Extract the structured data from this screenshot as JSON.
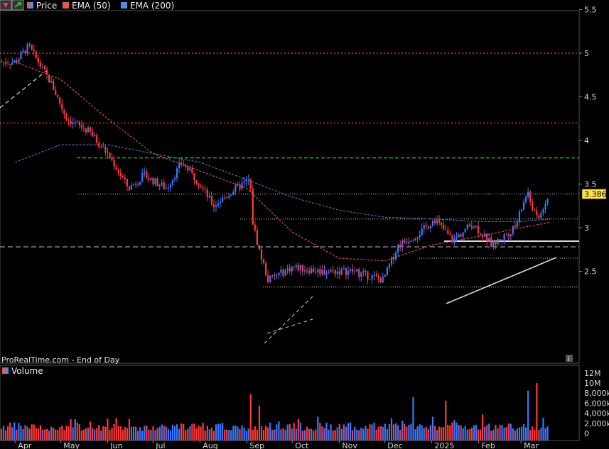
{
  "header": {
    "price_label": "Price",
    "ema50_label": "EMA (50)",
    "ema200_label": "EMA (200)",
    "colors": {
      "price_swatch": "#e05a5a",
      "ema50": "#e05a5a",
      "ema200": "#5a8ae0"
    }
  },
  "watermark": "ProRealTime.com - End of Day",
  "info_icon": "info-icon",
  "volume_panel": {
    "label": "Volume"
  },
  "last_price": "3.386",
  "colors": {
    "up": "#3a78ff",
    "down": "#ff3a3a",
    "ema50": "#d2534a",
    "ema200": "#4d6fb8",
    "resistance": "#ff2a2a",
    "support_green": "#33cc33",
    "last_price_box": "#ffe24a"
  },
  "chart_data": [
    {
      "type": "candlestick",
      "title": "",
      "y_axis": {
        "ticks": [
          "5.5",
          "5",
          "4.5",
          "4",
          "3.5",
          "3",
          "2.5"
        ],
        "range": [
          2.2,
          5.6
        ]
      },
      "x_axis": {
        "ticks": [
          "Apr",
          "May",
          "Jun",
          "Jul",
          "Aug",
          "Sep",
          "Oct",
          "Nov",
          "Dec",
          "2025",
          "Feb",
          "Mar"
        ]
      },
      "price_path": [
        [
          "2024-04-01",
          4.9
        ],
        [
          "2024-04-10",
          5.08
        ],
        [
          "2024-04-25",
          4.65
        ],
        [
          "2024-05-05",
          4.25
        ],
        [
          "2024-05-20",
          4.1
        ],
        [
          "2024-06-01",
          3.85
        ],
        [
          "2024-06-15",
          3.45
        ],
        [
          "2024-06-25",
          3.6
        ],
        [
          "2024-07-10",
          3.45
        ],
        [
          "2024-07-20",
          3.75
        ],
        [
          "2024-08-01",
          3.5
        ],
        [
          "2024-08-10",
          3.25
        ],
        [
          "2024-08-25",
          3.45
        ],
        [
          "2024-09-03",
          3.55
        ],
        [
          "2024-09-05",
          3.05
        ],
        [
          "2024-09-09",
          2.75
        ],
        [
          "2024-09-15",
          2.4
        ],
        [
          "2024-10-01",
          2.55
        ],
        [
          "2024-10-20",
          2.5
        ],
        [
          "2024-11-10",
          2.5
        ],
        [
          "2024-11-30",
          2.4
        ],
        [
          "2024-12-10",
          2.8
        ],
        [
          "2024-12-25",
          2.95
        ],
        [
          "2025-01-03",
          3.1
        ],
        [
          "2025-01-15",
          2.85
        ],
        [
          "2025-01-28",
          3.05
        ],
        [
          "2025-02-10",
          2.8
        ],
        [
          "2025-02-25",
          3.0
        ],
        [
          "2025-03-05",
          3.4
        ],
        [
          "2025-03-12",
          3.08
        ],
        [
          "2025-03-20",
          3.386
        ]
      ],
      "ema50_path": [
        [
          "2024-04-01",
          4.9
        ],
        [
          "2024-05-01",
          4.7
        ],
        [
          "2024-06-01",
          4.25
        ],
        [
          "2024-07-01",
          3.85
        ],
        [
          "2024-08-01",
          3.65
        ],
        [
          "2024-09-01",
          3.45
        ],
        [
          "2024-10-01",
          2.95
        ],
        [
          "2024-11-01",
          2.65
        ],
        [
          "2024-12-01",
          2.62
        ],
        [
          "2025-01-01",
          2.8
        ],
        [
          "2025-02-01",
          2.9
        ],
        [
          "2025-03-01",
          3.0
        ],
        [
          "2025-03-20",
          3.06
        ]
      ],
      "ema200_path": [
        [
          "2024-04-01",
          3.75
        ],
        [
          "2024-05-01",
          3.95
        ],
        [
          "2024-06-01",
          3.95
        ],
        [
          "2024-07-01",
          3.85
        ],
        [
          "2024-08-01",
          3.75
        ],
        [
          "2024-09-01",
          3.55
        ],
        [
          "2024-10-01",
          3.35
        ],
        [
          "2024-11-01",
          3.2
        ],
        [
          "2024-12-01",
          3.12
        ],
        [
          "2025-01-01",
          3.1
        ],
        [
          "2025-02-01",
          3.07
        ],
        [
          "2025-03-01",
          3.07
        ],
        [
          "2025-03-20",
          3.1
        ]
      ],
      "horizontal_levels": [
        {
          "value": 5.0,
          "style": "red-dotted"
        },
        {
          "value": 4.2,
          "style": "red-dotted"
        },
        {
          "value": 3.8,
          "style": "green-dashed"
        },
        {
          "value": 3.386,
          "style": "white-dotted"
        },
        {
          "value": 3.1,
          "style": "white-dotted"
        },
        {
          "value": 2.78,
          "style": "white-dashed"
        },
        {
          "value": 2.65,
          "style": "white-dotted"
        },
        {
          "value": 2.32,
          "style": "white-dotted"
        }
      ],
      "last_price": 3.386
    },
    {
      "type": "bar",
      "title": "Volume",
      "y_axis": {
        "ticks": [
          "12M",
          "10M",
          "8,000k",
          "6,000k",
          "4,000k",
          "2,000k",
          "0"
        ],
        "range": [
          0,
          12000000
        ]
      },
      "notable_values": [
        [
          "2024-09-03",
          7800000
        ],
        [
          "2024-09-09",
          5500000
        ],
        [
          "2024-12-20",
          7200000
        ],
        [
          "2025-01-10",
          6500000
        ],
        [
          "2025-03-05",
          8500000
        ],
        [
          "2025-03-12",
          10000000
        ]
      ]
    }
  ]
}
